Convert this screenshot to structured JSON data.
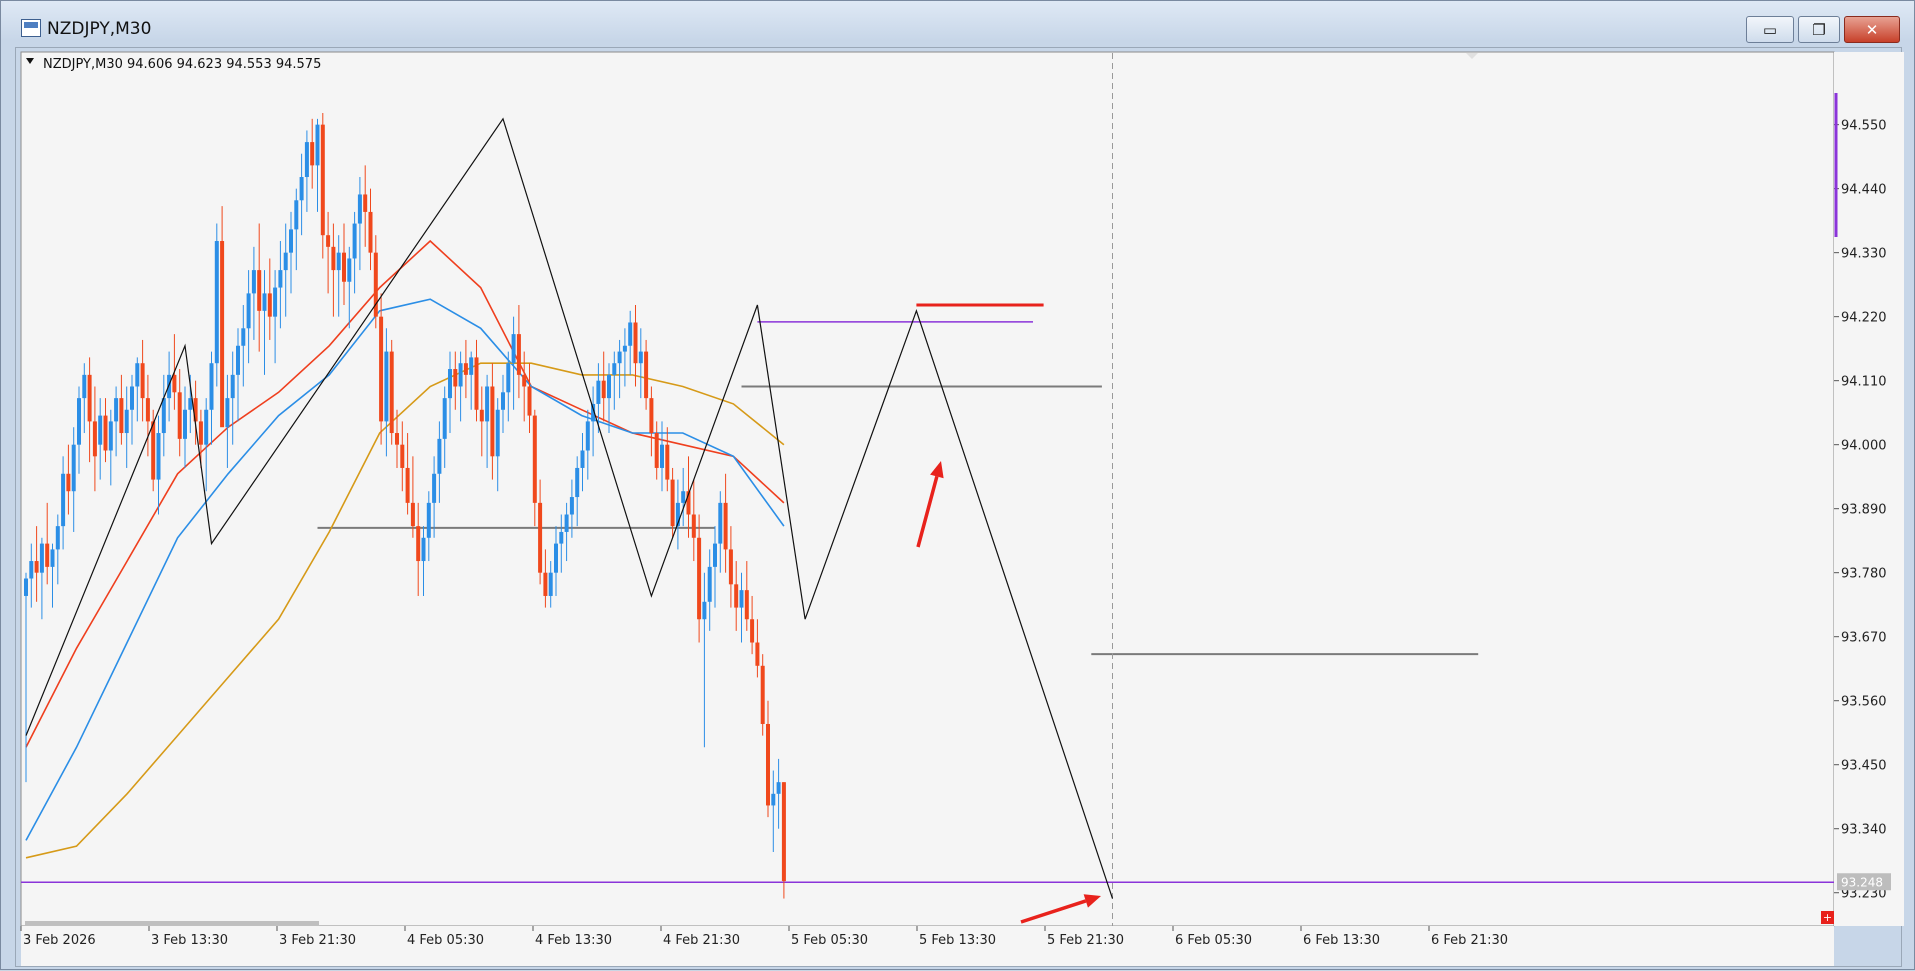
{
  "window": {
    "title": "NZDJPY,M30",
    "minimize_label": "▭",
    "maximize_label": "❐",
    "close_label": "✕"
  },
  "chart_header": {
    "text": "NZDJPY,M30  94.606 94.623 94.553 94.575"
  },
  "price_badge": "93.248",
  "colors": {
    "bull": "#2b8ee6",
    "bear": "#f0481c",
    "ema_fast": "#ef3f1e",
    "ema_mid": "#2b8ee6",
    "ema_slow": "#d69a18",
    "purple": "#8a34d9",
    "gray_level": "#7a7a7a",
    "arrow": "#e8221c"
  },
  "chart_data": {
    "type": "candlestick",
    "symbol": "NZDJPY",
    "timeframe": "M30",
    "ylim": [
      93.19,
      94.625
    ],
    "y_ticks": [
      "94.550",
      "94.440",
      "94.330",
      "94.220",
      "94.110",
      "94.000",
      "93.890",
      "93.780",
      "93.670",
      "93.560",
      "93.450",
      "93.340",
      "93.230"
    ],
    "x_ticks": [
      "3 Feb 2026",
      "3 Feb 13:30",
      "3 Feb 21:30",
      "4 Feb 05:30",
      "4 Feb 13:30",
      "4 Feb 21:30",
      "5 Feb 05:30",
      "5 Feb 13:30",
      "5 Feb 21:30",
      "6 Feb 05:30",
      "6 Feb 13:30",
      "6 Feb 21:30"
    ],
    "last_price": 93.248,
    "ohlc": [
      [
        93.74,
        93.78,
        93.42,
        93.77
      ],
      [
        93.77,
        93.83,
        93.72,
        93.8
      ],
      [
        93.8,
        93.86,
        93.73,
        93.78
      ],
      [
        93.78,
        93.84,
        93.7,
        93.83
      ],
      [
        93.83,
        93.9,
        93.76,
        93.79
      ],
      [
        93.79,
        93.83,
        93.72,
        93.82
      ],
      [
        93.82,
        93.88,
        93.76,
        93.86
      ],
      [
        93.86,
        93.98,
        93.82,
        93.95
      ],
      [
        93.95,
        94.0,
        93.88,
        93.92
      ],
      [
        93.92,
        94.03,
        93.85,
        94.0
      ],
      [
        94.0,
        94.1,
        93.95,
        94.08
      ],
      [
        94.08,
        94.14,
        94.02,
        94.12
      ],
      [
        94.12,
        94.15,
        93.97,
        94.04
      ],
      [
        94.04,
        94.1,
        93.92,
        93.98
      ],
      [
        94.0,
        94.08,
        93.94,
        94.05
      ],
      [
        94.05,
        94.08,
        93.97,
        93.99
      ],
      [
        93.99,
        94.06,
        93.93,
        94.04
      ],
      [
        94.04,
        94.1,
        93.98,
        94.08
      ],
      [
        94.08,
        94.12,
        94.0,
        94.02
      ],
      [
        94.02,
        94.1,
        93.96,
        94.06
      ],
      [
        94.06,
        94.12,
        94.0,
        94.1
      ],
      [
        94.1,
        94.15,
        94.04,
        94.14
      ],
      [
        94.14,
        94.18,
        94.04,
        94.08
      ],
      [
        94.08,
        94.12,
        93.98,
        94.04
      ],
      [
        94.04,
        94.06,
        93.92,
        93.94
      ],
      [
        93.94,
        94.05,
        93.88,
        94.02
      ],
      [
        94.02,
        94.12,
        93.98,
        94.08
      ],
      [
        94.08,
        94.16,
        94.04,
        94.12
      ],
      [
        94.12,
        94.19,
        94.06,
        94.09
      ],
      [
        94.09,
        94.13,
        93.98,
        94.01
      ],
      [
        94.01,
        94.1,
        93.96,
        94.06
      ],
      [
        94.06,
        94.12,
        94.02,
        94.08
      ],
      [
        94.08,
        94.11,
        94.0,
        94.04
      ],
      [
        94.04,
        94.06,
        93.96,
        94.0
      ],
      [
        94.0,
        94.08,
        93.92,
        94.06
      ],
      [
        94.06,
        94.16,
        94.0,
        94.14
      ],
      [
        94.14,
        94.38,
        94.1,
        94.35
      ],
      [
        94.35,
        94.41,
        94.1,
        94.03
      ],
      [
        94.03,
        94.12,
        93.96,
        94.08
      ],
      [
        94.08,
        94.16,
        94.0,
        94.12
      ],
      [
        94.12,
        94.2,
        94.04,
        94.17
      ],
      [
        94.17,
        94.24,
        94.1,
        94.2
      ],
      [
        94.2,
        94.3,
        94.14,
        94.26
      ],
      [
        94.26,
        94.34,
        94.18,
        94.3
      ],
      [
        94.3,
        94.38,
        94.16,
        94.23
      ],
      [
        94.23,
        94.3,
        94.12,
        94.26
      ],
      [
        94.26,
        94.32,
        94.18,
        94.22
      ],
      [
        94.22,
        94.3,
        94.14,
        94.27
      ],
      [
        94.27,
        94.35,
        94.2,
        94.3
      ],
      [
        94.3,
        94.38,
        94.22,
        94.33
      ],
      [
        94.33,
        94.4,
        94.26,
        94.37
      ],
      [
        94.37,
        94.44,
        94.3,
        94.42
      ],
      [
        94.42,
        94.5,
        94.36,
        94.46
      ],
      [
        94.46,
        94.54,
        94.4,
        94.52
      ],
      [
        94.52,
        94.56,
        94.44,
        94.48
      ],
      [
        94.48,
        94.56,
        94.4,
        94.55
      ],
      [
        94.55,
        94.57,
        94.32,
        94.36
      ],
      [
        94.36,
        94.4,
        94.26,
        94.34
      ],
      [
        94.34,
        94.38,
        94.22,
        94.3
      ],
      [
        94.3,
        94.36,
        94.22,
        94.33
      ],
      [
        94.33,
        94.38,
        94.24,
        94.28
      ],
      [
        94.28,
        94.34,
        94.2,
        94.32
      ],
      [
        94.32,
        94.4,
        94.26,
        94.38
      ],
      [
        94.38,
        94.46,
        94.3,
        94.43
      ],
      [
        94.43,
        94.48,
        94.34,
        94.4
      ],
      [
        94.4,
        94.44,
        94.3,
        94.33
      ],
      [
        94.33,
        94.36,
        94.2,
        94.22
      ],
      [
        94.22,
        94.26,
        94.0,
        94.04
      ],
      [
        94.04,
        94.2,
        93.98,
        94.16
      ],
      [
        94.16,
        94.18,
        94.0,
        94.02
      ],
      [
        94.02,
        94.06,
        93.96,
        94.0
      ],
      [
        94.0,
        94.04,
        93.92,
        93.96
      ],
      [
        93.96,
        94.02,
        93.88,
        93.9
      ],
      [
        93.9,
        93.98,
        93.84,
        93.86
      ],
      [
        93.86,
        93.9,
        93.74,
        93.8
      ],
      [
        93.8,
        93.86,
        93.74,
        93.84
      ],
      [
        93.84,
        93.92,
        93.8,
        93.9
      ],
      [
        93.9,
        93.98,
        93.84,
        93.95
      ],
      [
        93.95,
        94.04,
        93.9,
        94.01
      ],
      [
        94.01,
        94.1,
        93.96,
        94.08
      ],
      [
        94.08,
        94.16,
        94.02,
        94.13
      ],
      [
        94.13,
        94.16,
        94.06,
        94.1
      ],
      [
        94.1,
        94.16,
        94.04,
        94.14
      ],
      [
        94.14,
        94.18,
        94.08,
        94.12
      ],
      [
        94.12,
        94.16,
        94.06,
        94.15
      ],
      [
        94.15,
        94.18,
        94.04,
        94.06
      ],
      [
        94.06,
        94.1,
        93.98,
        94.04
      ],
      [
        94.04,
        94.12,
        93.96,
        94.1
      ],
      [
        94.1,
        94.14,
        93.94,
        93.98
      ],
      [
        93.98,
        94.08,
        93.92,
        94.06
      ],
      [
        94.06,
        94.12,
        94.02,
        94.09
      ],
      [
        94.09,
        94.16,
        94.04,
        94.14
      ],
      [
        94.14,
        94.22,
        94.06,
        94.19
      ],
      [
        94.19,
        94.24,
        94.08,
        94.12
      ],
      [
        94.12,
        94.16,
        94.04,
        94.1
      ],
      [
        94.1,
        94.14,
        94.02,
        94.05
      ],
      [
        94.05,
        94.06,
        93.86,
        93.9
      ],
      [
        93.9,
        93.94,
        93.76,
        93.78
      ],
      [
        93.78,
        93.82,
        93.72,
        93.74
      ],
      [
        93.74,
        93.8,
        93.72,
        93.78
      ],
      [
        93.78,
        93.86,
        93.74,
        93.83
      ],
      [
        93.83,
        93.88,
        93.78,
        93.85
      ],
      [
        93.85,
        93.9,
        93.8,
        93.88
      ],
      [
        93.88,
        93.94,
        93.84,
        93.91
      ],
      [
        93.91,
        93.98,
        93.86,
        93.96
      ],
      [
        93.96,
        94.02,
        93.92,
        93.99
      ],
      [
        93.99,
        94.06,
        93.94,
        94.04
      ],
      [
        94.04,
        94.1,
        93.98,
        94.07
      ],
      [
        94.07,
        94.14,
        94.02,
        94.11
      ],
      [
        94.11,
        94.16,
        94.04,
        94.08
      ],
      [
        94.08,
        94.14,
        94.02,
        94.12
      ],
      [
        94.12,
        94.16,
        94.06,
        94.14
      ],
      [
        94.14,
        94.18,
        94.08,
        94.16
      ],
      [
        94.16,
        94.2,
        94.1,
        94.17
      ],
      [
        94.17,
        94.23,
        94.12,
        94.21
      ],
      [
        94.21,
        94.24,
        94.1,
        94.14
      ],
      [
        94.14,
        94.2,
        94.08,
        94.16
      ],
      [
        94.16,
        94.18,
        94.06,
        94.08
      ],
      [
        94.08,
        94.1,
        93.98,
        94.02
      ],
      [
        94.02,
        94.04,
        93.94,
        93.96
      ],
      [
        93.96,
        94.04,
        93.92,
        94.0
      ],
      [
        94.0,
        94.03,
        93.92,
        93.94
      ],
      [
        93.94,
        93.96,
        93.84,
        93.86
      ],
      [
        93.86,
        93.94,
        93.82,
        93.9
      ],
      [
        93.9,
        93.96,
        93.86,
        93.92
      ],
      [
        93.92,
        93.98,
        93.84,
        93.88
      ],
      [
        93.88,
        93.94,
        93.8,
        93.84
      ],
      [
        93.84,
        93.88,
        93.66,
        93.7
      ],
      [
        93.7,
        93.78,
        93.48,
        93.73
      ],
      [
        93.73,
        93.82,
        93.68,
        93.79
      ],
      [
        93.79,
        93.86,
        93.72,
        93.83
      ],
      [
        93.83,
        93.92,
        93.78,
        93.9
      ],
      [
        93.9,
        93.95,
        93.78,
        93.82
      ],
      [
        93.82,
        93.86,
        93.72,
        93.76
      ],
      [
        93.76,
        93.8,
        93.68,
        93.72
      ],
      [
        93.72,
        93.78,
        93.66,
        93.75
      ],
      [
        93.75,
        93.8,
        93.68,
        93.7
      ],
      [
        93.7,
        93.74,
        93.64,
        93.66
      ],
      [
        93.66,
        93.7,
        93.6,
        93.62
      ],
      [
        93.62,
        93.64,
        93.5,
        93.52
      ],
      [
        93.52,
        93.56,
        93.36,
        93.38
      ],
      [
        93.38,
        93.44,
        93.3,
        93.4
      ],
      [
        93.4,
        93.46,
        93.34,
        93.42
      ],
      [
        93.42,
        93.42,
        93.22,
        93.25
      ]
    ],
    "indicators": [
      {
        "name": "ema_fast",
        "color": "#ef3f1e",
        "values": [
          93.48,
          93.65,
          93.8,
          93.95,
          94.03,
          94.09,
          94.17,
          94.27,
          94.35,
          94.27,
          94.1,
          94.06,
          94.02,
          94.0,
          93.98,
          93.9
        ]
      },
      {
        "name": "ema_mid",
        "color": "#2b8ee6",
        "values": [
          93.32,
          93.48,
          93.66,
          93.84,
          93.95,
          94.05,
          94.12,
          94.23,
          94.25,
          94.2,
          94.1,
          94.05,
          94.02,
          94.02,
          93.98,
          93.86
        ]
      },
      {
        "name": "ema_slow",
        "color": "#d69a18",
        "values": [
          93.29,
          93.31,
          93.4,
          93.5,
          93.6,
          93.7,
          93.85,
          94.02,
          94.1,
          94.14,
          94.14,
          94.12,
          94.12,
          94.1,
          94.07,
          94.0
        ]
      }
    ],
    "zigzag": [
      [
        0,
        93.5
      ],
      [
        30,
        94.17
      ],
      [
        35,
        93.83
      ],
      [
        90,
        94.56
      ],
      [
        118,
        93.74
      ],
      [
        138,
        94.24
      ],
      [
        147,
        93.7
      ],
      [
        168,
        94.23
      ],
      [
        205,
        93.22
      ]
    ],
    "levels": [
      {
        "name": "purple-resistance-line",
        "price": 94.211,
        "from": 138,
        "to": 190,
        "color": "#8a34d9",
        "width": 1.5
      },
      {
        "name": "red-resistance-line",
        "price": 94.24,
        "from": 168,
        "to": 192,
        "color": "#e8221c",
        "width": 3
      },
      {
        "name": "gray-level-upper",
        "price": 94.1,
        "from": 135,
        "to": 203,
        "color": "#7a7a7a",
        "width": 2
      },
      {
        "name": "gray-level-mid",
        "price": 93.857,
        "from": 55,
        "to": 130,
        "color": "#7a7a7a",
        "width": 2
      },
      {
        "name": "gray-level-lower",
        "price": 93.64,
        "from": 201,
        "to": 274,
        "color": "#7a7a7a",
        "width": 2
      }
    ],
    "current_price_line": {
      "price": 93.248,
      "color": "#8a34d9"
    },
    "vertical_marker_bar": 205
  }
}
